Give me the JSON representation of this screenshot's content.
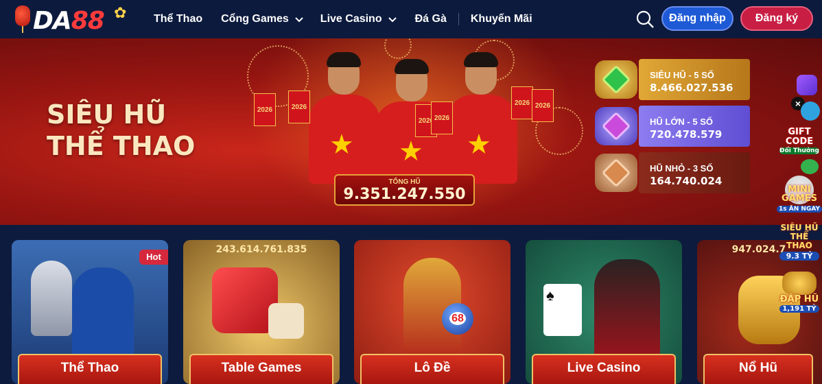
{
  "header": {
    "logo_text_letters": "DA",
    "logo_text_number": "88",
    "nav": [
      {
        "label": "Thể Thao"
      },
      {
        "label": "Cổng Games"
      },
      {
        "label": "Live Casino"
      },
      {
        "label": "Đá Gà"
      },
      {
        "label": "Khuyến Mãi"
      }
    ],
    "login_label": "Đăng nhập",
    "register_label": "Đăng ký"
  },
  "banner": {
    "title_line1": "SIÊU HŨ",
    "title_line2": "THỂ THAO",
    "envelope_text": "2026",
    "total_label": "TỔNG HŨ",
    "total_value": "9.351.247.550",
    "jackpots": [
      {
        "name": "SIÊU HŨ - 5 SỐ",
        "value": "8.466.027.536",
        "color": "#d9a12c"
      },
      {
        "name": "HŨ LỚN - 5 SỐ",
        "value": "720.478.579",
        "color": "#8e7bf2"
      },
      {
        "name": "HŨ NHỎ - 3 SỐ",
        "value": "164.740.024",
        "color": "#c88f5a"
      }
    ]
  },
  "cards": [
    {
      "label": "Thể Thao",
      "badge": "Hot",
      "amount": ""
    },
    {
      "label": "Table Games",
      "badge": "",
      "amount": "243.614.761.835"
    },
    {
      "label": "Lô Đề",
      "badge": "",
      "amount": "",
      "ball_number": "68"
    },
    {
      "label": "Live Casino",
      "badge": "",
      "amount": ""
    },
    {
      "label": "Nổ Hũ",
      "badge": "",
      "amount": "947.024.7"
    }
  ],
  "side_widgets": {
    "giftcode_line1": "GIFT",
    "giftcode_line2": "CODE",
    "giftcode_sub": "Đổi Thưởng",
    "mini_line1": "MINI",
    "mini_line2": "GAMES",
    "mini_sub": "1s ĂN NGAY",
    "sieuhu_line1": "SIÊU HŨ",
    "sieuhu_line2": "THỂ THAO",
    "sieuhu_value": "9.3 TỶ",
    "daphu_line1": "ĐẬP HŨ",
    "daphu_value": "1,191 TỶ"
  }
}
